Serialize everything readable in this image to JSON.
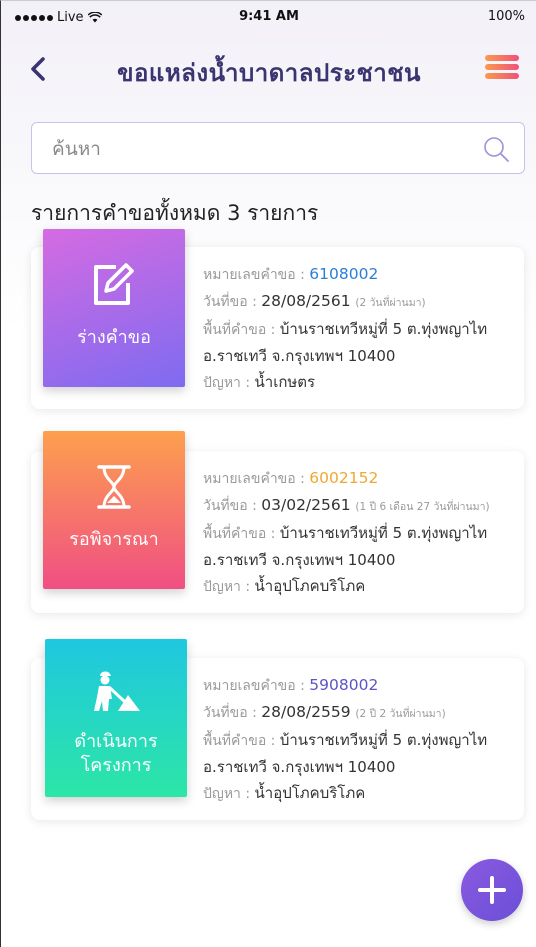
{
  "status_bar": {
    "carrier": "Live",
    "time": "9:41 AM",
    "battery": "100%"
  },
  "header": {
    "title": "ขอแหล่งน้ำบาดาลประชาชน"
  },
  "search": {
    "placeholder": "ค้นหา"
  },
  "summary": {
    "text": "รายการคำขอทั้งหมด  3  รายการ"
  },
  "labels": {
    "request_no": "หมายเลขคำขอ : ",
    "date": "วันที่ขอ : ",
    "area": "พื้นที่คำขอ : ",
    "problem": "ปัญหา : "
  },
  "requests": [
    {
      "status_label": "ร่างคำขอ",
      "status_icon": "edit-icon",
      "request_no": "6108002",
      "request_no_color": "#2a7fd6",
      "date": "28/08/2561",
      "since": "(2 วันที่ผ่านมา)",
      "area_line1": "บ้านราชเทวีหมู่ที่ 5 ต.ทุ่งพญาไท",
      "area_line2": "อ.ราชเทวี จ.กรุงเทพฯ 10400",
      "problem": "น้ำเกษตร"
    },
    {
      "status_label": "รอพิจารณา",
      "status_icon": "hourglass-icon",
      "request_no": "6002152",
      "request_no_color": "#f0a830",
      "date": "03/02/2561",
      "since": "(1 ปี 6 เดือน 27 วันที่ผ่านมา)",
      "area_line1": "บ้านราชเทวีหมู่ที่ 5 ต.ทุ่งพญาไท",
      "area_line2": "อ.ราชเทวี จ.กรุงเทพฯ 10400",
      "problem": "น้ำอุปโภคบริโภค"
    },
    {
      "status_label_line1": "ดำเนินการ",
      "status_label_line2": "โครงการ",
      "status_icon": "construction-worker-icon",
      "request_no": "5908002",
      "request_no_color": "#5b55c8",
      "date": "28/08/2559",
      "since": "(2 ปี 2 วันที่ผ่านมา)",
      "area_line1": "บ้านราชเทวีหมู่ที่ 5 ต.ทุ่งพญาไท",
      "area_line2": "อ.ราชเทวี จ.กรุงเทพฯ 10400",
      "problem": "น้ำอุปโภคบริโภค"
    }
  ],
  "colors": {
    "title": "#3a3470",
    "accent": "#6a4fd6",
    "menu_gradient": [
      "#fb9a4e",
      "#f0517a"
    ]
  }
}
